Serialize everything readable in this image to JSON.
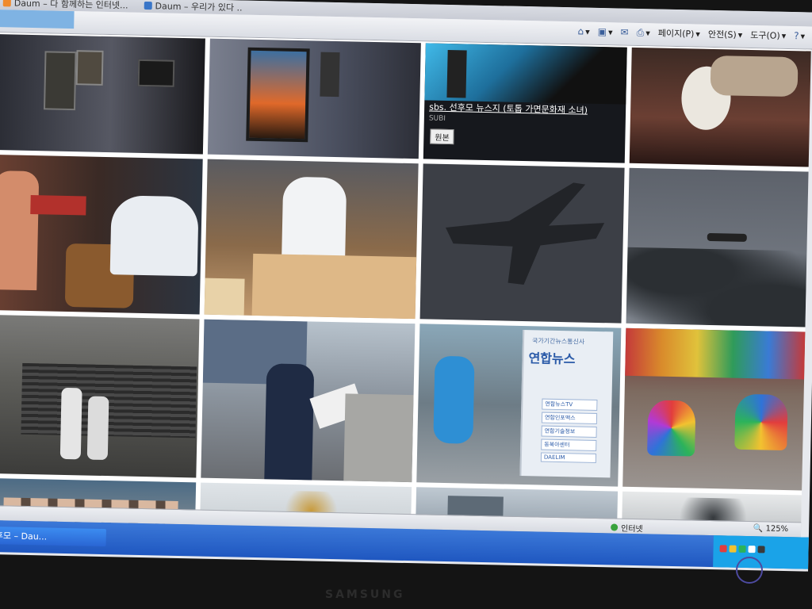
{
  "browser": {
    "tabs": [
      {
        "label": "Daum – 다 함께하는 인터넷...",
        "icon": "daum-icon"
      },
      {
        "label": "Daum – 우리가 있다 ..",
        "icon": "daum-icon"
      }
    ],
    "commands": [
      {
        "label": "",
        "icon": "home-icon"
      },
      {
        "label": "",
        "icon": "feed-icon"
      },
      {
        "label": "",
        "icon": "mail-icon"
      },
      {
        "label": "",
        "icon": "print-icon"
      },
      {
        "label": "페이지(P)",
        "icon": "page-icon"
      },
      {
        "label": "안전(S)",
        "icon": "safety-icon"
      },
      {
        "label": "도구(O)",
        "icon": "tools-icon"
      },
      {
        "label": "",
        "icon": "help-icon"
      }
    ]
  },
  "gallery": {
    "overlay": {
      "title": "sbs. 선후모 뉴스지 (토톱 가면문화재 소녀)",
      "subtitle": "SUBI",
      "button": "원본"
    },
    "sign": {
      "top": "국가기간뉴스통신사",
      "brand": "연합뉴스",
      "items": [
        "연합뉴스TV",
        "연합인포맥스",
        "연합기술정보",
        "동북아센터",
        "DAELIM"
      ]
    }
  },
  "status": {
    "zone": "인터넷",
    "zoom": "125%"
  },
  "taskbar": {
    "task_label": "선후모 – Dau..."
  },
  "monitor": {
    "brand": "SAMSUNG"
  }
}
